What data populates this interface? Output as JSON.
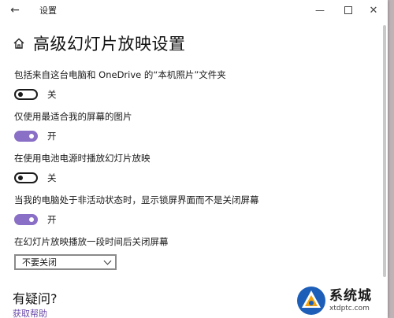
{
  "window": {
    "title": "设置",
    "back_glyph": "←",
    "minimize_glyph": "—",
    "close_glyph": "✕"
  },
  "page": {
    "title": "高级幻灯片放映设置"
  },
  "settings": [
    {
      "label": "包括来自这台电脑和 OneDrive 的“本机照片”文件夹",
      "state": "关",
      "on": false
    },
    {
      "label": "仅使用最适合我的屏幕的图片",
      "state": "开",
      "on": true
    },
    {
      "label": "在使用电池电源时播放幻灯片放映",
      "state": "关",
      "on": false
    },
    {
      "label": "当我的电脑处于非活动状态时，显示锁屏界面而不是关闭屏幕",
      "state": "开",
      "on": true
    }
  ],
  "screen_off": {
    "label": "在幻灯片放映播放一段时间后关闭屏幕",
    "value": "不要关闭"
  },
  "faq": {
    "title": "有疑问?",
    "link": "获取帮助"
  },
  "watermark": {
    "name": "系统城",
    "url": "xtdptc.com"
  },
  "colors": {
    "accent": "#8a6fc6",
    "background": "#ffffff"
  }
}
